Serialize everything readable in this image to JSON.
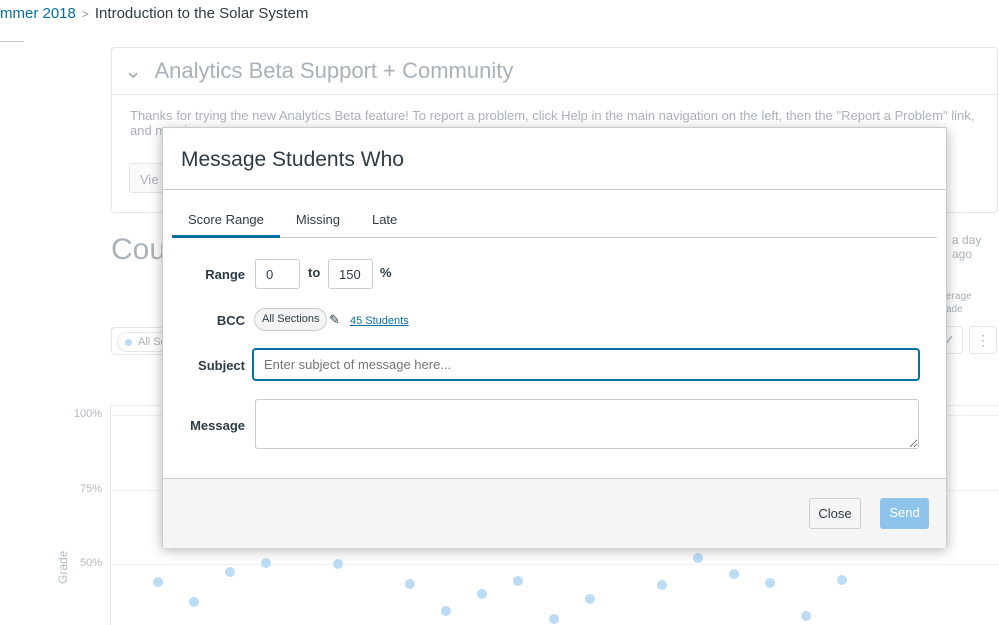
{
  "breadcrumb": {
    "term": "mmer 2018",
    "course": "Introduction to the Solar System"
  },
  "background": {
    "panel_title": "Analytics Beta Support + Community",
    "panel_text": "Thanks for trying the new Analytics Beta feature! To report a problem, click Help in the main navigation on the left, then the \"Report a Problem\" link, and menti",
    "view_button": "Vie",
    "course_heading": "Cou",
    "updated": "a day ago",
    "average_label_1": "erage",
    "average_label_2": "ade",
    "section_filter": "All Se"
  },
  "chart_data": {
    "type": "scatter",
    "ylabel": "Grade",
    "yticks": [
      "100%",
      "75%",
      "50%"
    ],
    "ylim": [
      30,
      100
    ],
    "points": [
      [
        0,
        44
      ],
      [
        1,
        37.3
      ],
      [
        2,
        47.3
      ],
      [
        3,
        50.3
      ],
      [
        5,
        50
      ],
      [
        7,
        43.3
      ],
      [
        8,
        34.3
      ],
      [
        9,
        40
      ],
      [
        10,
        44.3
      ],
      [
        11,
        31.7
      ],
      [
        12,
        38.3
      ],
      [
        14,
        43
      ],
      [
        15,
        52
      ],
      [
        16,
        46.7
      ],
      [
        17,
        43.7
      ],
      [
        18,
        32.7
      ],
      [
        19,
        44.7
      ]
    ],
    "point_color": "#bcdcf5"
  },
  "modal": {
    "title": "Message Students Who",
    "tabs": [
      {
        "label": "Score Range",
        "active": true
      },
      {
        "label": "Missing"
      },
      {
        "label": "Late"
      }
    ],
    "range_label": "Range",
    "range_from": "0",
    "range_to_label": "to",
    "range_to": "150",
    "range_unit": "%",
    "bcc_label": "BCC",
    "bcc_pill": "All Sections",
    "students_link": "45 Students",
    "subject_label": "Subject",
    "subject_placeholder": "Enter subject of message here...",
    "message_label": "Message",
    "close": "Close",
    "send": "Send",
    "accent": "#0770a3",
    "send_color": "#8ec3ec"
  }
}
